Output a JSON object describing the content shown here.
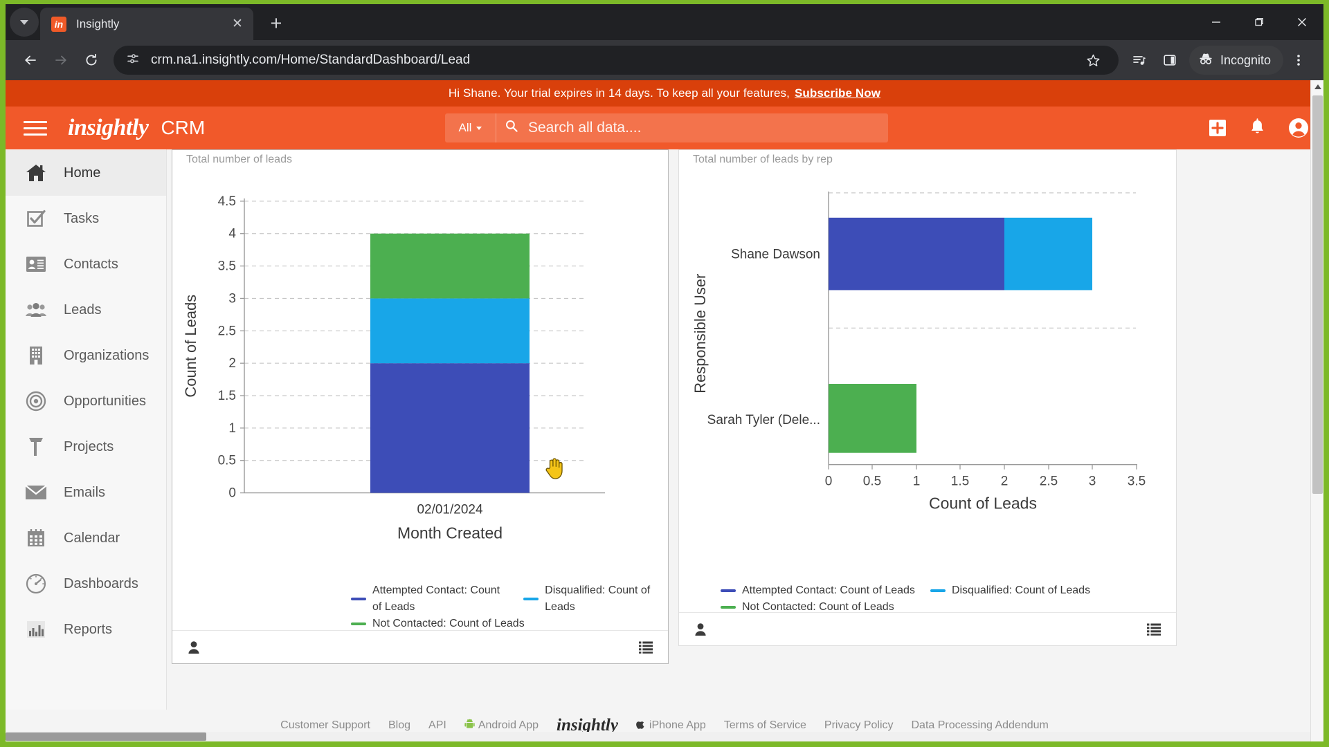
{
  "browser": {
    "tab": {
      "title": "Insightly",
      "favicon": "insightly-favicon",
      "close": "✕"
    },
    "new_tab_label": "+",
    "window_controls": {
      "minimize": "minimize-icon",
      "maximize": "maximize-icon",
      "close": "close-icon"
    },
    "url": "crm.na1.insightly.com/Home/StandardDashboard/Lead",
    "back": "back-icon",
    "forward": "forward-icon",
    "reload": "reload-icon",
    "site_info": "site-settings-icon",
    "bookmark": "star-icon",
    "reading_list": "reading-list-icon",
    "side_panel": "side-panel-icon",
    "incognito_label": "Incognito",
    "menu": "kebab-menu-icon"
  },
  "banner": {
    "message": "Hi Shane. Your trial expires in 14 days. To keep all your features,",
    "cta": "Subscribe Now",
    "bg": "#d9400b"
  },
  "header": {
    "brand": "insightly",
    "product": "CRM",
    "bg": "#f1592a",
    "search": {
      "scope": "All",
      "placeholder": "Search all data...."
    },
    "actions": [
      {
        "name": "add-button",
        "icon": "plus-square-icon"
      },
      {
        "name": "notifications-button",
        "icon": "bell-icon"
      },
      {
        "name": "account-button",
        "icon": "user-circle-icon"
      }
    ]
  },
  "sidebar": {
    "items": [
      {
        "label": "Home",
        "icon": "home-icon",
        "active": true
      },
      {
        "label": "Tasks",
        "icon": "task-checkbox-icon",
        "active": false
      },
      {
        "label": "Contacts",
        "icon": "contact-card-icon",
        "active": false
      },
      {
        "label": "Leads",
        "icon": "people-icon",
        "active": false
      },
      {
        "label": "Organizations",
        "icon": "building-icon",
        "active": false
      },
      {
        "label": "Opportunities",
        "icon": "target-icon",
        "active": false
      },
      {
        "label": "Projects",
        "icon": "hammer-icon",
        "active": false
      },
      {
        "label": "Emails",
        "icon": "envelope-icon",
        "active": false
      },
      {
        "label": "Calendar",
        "icon": "calendar-icon",
        "active": false
      },
      {
        "label": "Dashboards",
        "icon": "gauge-icon",
        "active": false
      },
      {
        "label": "Reports",
        "icon": "bar-chart-icon",
        "active": false
      }
    ]
  },
  "cards": [
    {
      "title": "Total number of leads",
      "owner_icon": "user-silhouette-icon",
      "menu_icon": "list-menu-icon"
    },
    {
      "title": "Total number of leads by rep",
      "owner_icon": "user-silhouette-icon",
      "menu_icon": "list-menu-icon"
    }
  ],
  "page_footer": {
    "links": [
      "Customer Support",
      "Blog",
      "API",
      "Android App",
      "iPhone App",
      "Terms of Service",
      "Privacy Policy",
      "Data Processing Addendum"
    ],
    "brand": "insightly",
    "android_icon": "android-icon",
    "apple_icon": "apple-icon"
  },
  "colors": {
    "attempted_contact": "#3d4db7",
    "disqualified": "#18a6e8",
    "not_contacted": "#4caf50",
    "accent": "#f1592a",
    "desktop": "#7cb928"
  },
  "chart_data": [
    {
      "type": "bar",
      "stacked": true,
      "orientation": "vertical",
      "title": "Total number of leads",
      "xlabel": "Month Created",
      "ylabel": "Count of Leads",
      "categories": [
        "02/01/2024"
      ],
      "ylim": [
        0,
        4.5
      ],
      "yticks": [
        "0",
        "0.5",
        "1",
        "1.5",
        "2",
        "2.5",
        "3",
        "3.5",
        "4",
        "4.5"
      ],
      "grid": true,
      "legend_position": "bottom",
      "series": [
        {
          "name": "Attempted Contact: Count of Leads",
          "color": "#3d4db7",
          "values": [
            2
          ]
        },
        {
          "name": "Disqualified: Count of Leads",
          "color": "#18a6e8",
          "values": [
            1
          ]
        },
        {
          "name": "Not Contacted: Count of Leads",
          "color": "#4caf50",
          "values": [
            1
          ]
        }
      ],
      "total": 4
    },
    {
      "type": "bar",
      "stacked": true,
      "orientation": "horizontal",
      "title": "Total number of leads by rep",
      "xlabel": "Count of Leads",
      "ylabel": "Responsible User",
      "categories": [
        "Shane Dawson",
        "Sarah Tyler (Dele..."
      ],
      "xlim": [
        0,
        3.5
      ],
      "xticks": [
        "0",
        "0.5",
        "1",
        "1.5",
        "2",
        "2.5",
        "3",
        "3.5"
      ],
      "grid": true,
      "legend_position": "bottom",
      "series": [
        {
          "name": "Attempted Contact: Count of Leads",
          "color": "#3d4db7",
          "values": [
            2,
            0
          ]
        },
        {
          "name": "Disqualified: Count of Leads",
          "color": "#18a6e8",
          "values": [
            1,
            0
          ]
        },
        {
          "name": "Not Contacted: Count of Leads",
          "color": "#4caf50",
          "values": [
            0,
            1
          ]
        }
      ]
    }
  ]
}
